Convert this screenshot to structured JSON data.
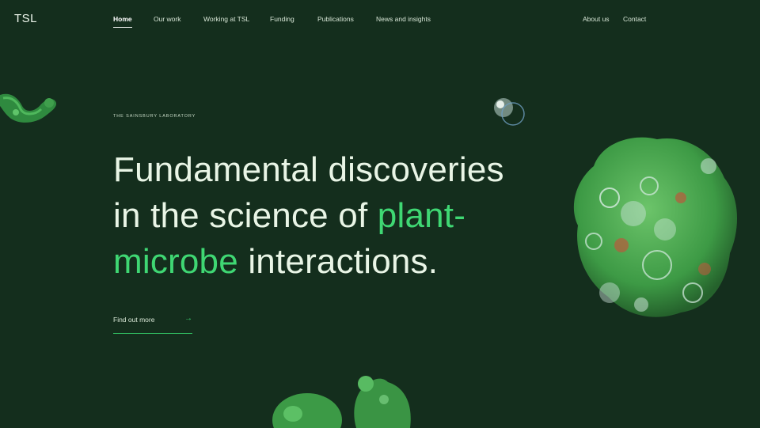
{
  "brand": {
    "logo_text": "TSL"
  },
  "nav": {
    "items": [
      {
        "label": "Home",
        "active": true
      },
      {
        "label": "Our work"
      },
      {
        "label": "Working at TSL"
      },
      {
        "label": "Funding"
      },
      {
        "label": "Publications"
      },
      {
        "label": "News and insights"
      }
    ],
    "right_items": [
      {
        "label": "About us"
      },
      {
        "label": "Contact"
      }
    ]
  },
  "hero": {
    "eyebrow": "THE SAINSBURY LABORATORY",
    "headline_line1": "Fundamental discoveries",
    "headline_line2_plain": "in the science of ",
    "headline_line2_accent": "plant-",
    "headline_line3_accent": "microbe",
    "headline_line3_plain": " interactions.",
    "cta_label": "Find out more",
    "cta_arrow": "→"
  },
  "colors": {
    "background": "#142e1d",
    "accent": "#3fd773",
    "text": "#e9f5e6"
  },
  "icons": {
    "cta_arrow": "arrow-right-icon"
  }
}
